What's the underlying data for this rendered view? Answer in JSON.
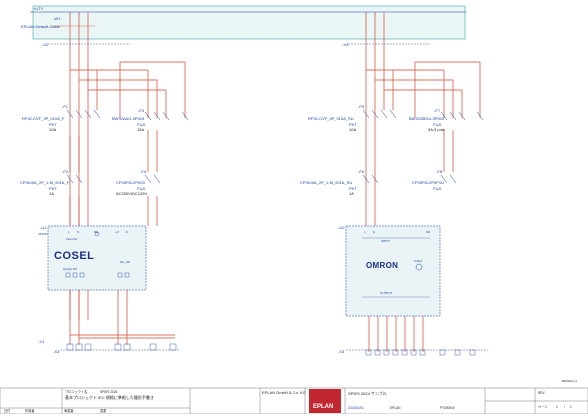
{
  "top_rail": {
    "label": "+UTY",
    "cable_id": "-W1",
    "cable_name": "EPLAN-Default-Cable"
  },
  "terminals_top": {
    "left": "-X2",
    "right": "-X4"
  },
  "left_breakers": {
    "f1": {
      "tag": "-F1",
      "part": "RF32-CVF_3P_010A_F",
      "maker": "PKT",
      "rating": "10A"
    },
    "f3": {
      "tag": "-F3",
      "part": "BW32AAG-3P015",
      "maker": "FUJI",
      "rating": "15A"
    },
    "f2": {
      "tag": "-F2",
      "part": "CP30-BA_2P_1-M_001A_F",
      "maker": "PKT",
      "rating": "1A"
    },
    "f4": {
      "tag": "-F4",
      "part": "CP30FM-2P003",
      "maker": "FUJI",
      "rating": "AC250V/DC125V"
    }
  },
  "right_breakers": {
    "f5": {
      "tag": "-F5",
      "part": "RF32-CVF_3P_010A_SU",
      "maker": "PKT",
      "rating": "10A"
    },
    "f7": {
      "tag": "-F7",
      "part": "BW32SBGU-3P003",
      "maker": "FUJI",
      "rating": "3A,3 pole"
    },
    "f6": {
      "tag": "-F6",
      "part": "CP30-BA_2P_1-M_001A_SU",
      "maker": "PKT",
      "rating": "1A"
    },
    "f8": {
      "tag": "-F8",
      "part": "CP30FM-2P0P1U",
      "maker": "FUJI",
      "rating": ""
    }
  },
  "psu_left": {
    "tag": "-U1",
    "note": "24VDC",
    "brand": "COSEL",
    "input_label": "Input AC",
    "output_label": "Output DC",
    "dc_ok": "DC_OK",
    "pins_top": [
      "L",
      "N",
      "PE",
      "+V",
      "-V"
    ]
  },
  "psu_right": {
    "tag": "-U2",
    "brand": "OMRON",
    "input_label": "INPUT",
    "output_label": "OUTPUT",
    "vadj": "V.ADJ",
    "pins_top": [
      "L",
      "N",
      "PE"
    ]
  },
  "terminals_bottom": {
    "left_group": "-X1",
    "left_strip": "-X3",
    "right_group": "-X3"
  },
  "page_ref": "BEMAN+/1",
  "title_block": {
    "project_label": "プロジェクト名",
    "project": "SPIES 2024",
    "description": "基本プロジェクト IEC 規格に準拠した雛形手書き",
    "company": "EPLAN GmbH & Co. KG",
    "title": "SPIES 2024 サンプル",
    "logo_text": "EPLAN",
    "col_labels": [
      "日付",
      "作成者",
      "承認者",
      "変更"
    ],
    "date": "2024/01/01",
    "drawn_by": "EPLAN",
    "doc_number": "PT000000",
    "page_label": "ページ",
    "page_value": "1",
    "of_label": "/",
    "total_pages": "1",
    "rev_label": "REV."
  }
}
